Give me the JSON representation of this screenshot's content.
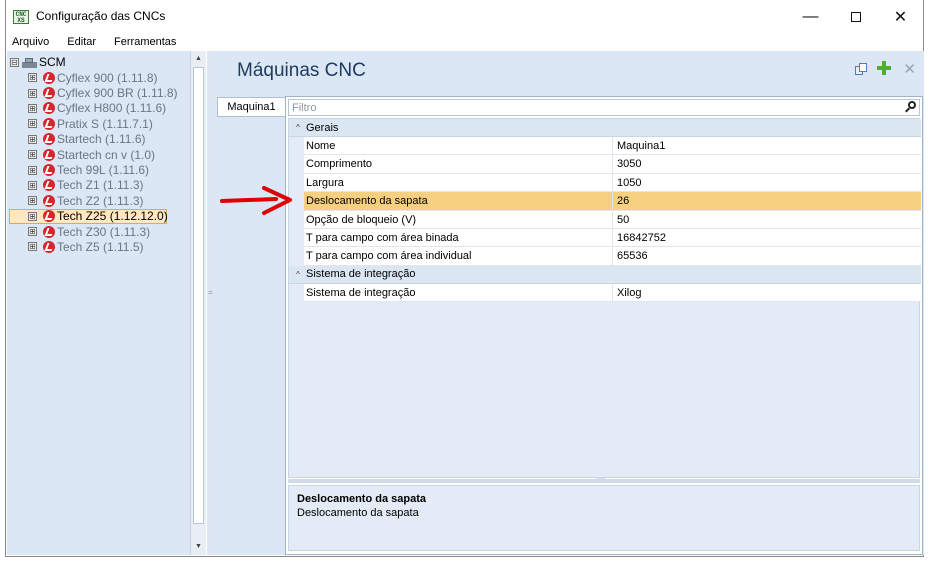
{
  "window": {
    "title": "Configuração das CNCs",
    "app_icon_text_top": "CNC",
    "app_icon_text_bottom": "XS"
  },
  "menu": [
    "Arquivo",
    "Editar",
    "Ferramentas"
  ],
  "tree": {
    "root": {
      "expander": "⊟",
      "label": "SCM"
    },
    "items": [
      {
        "expander": "⊞",
        "label": "Cyflex 900 (1.11.8)",
        "selected": false
      },
      {
        "expander": "⊞",
        "label": "Cyflex 900 BR (1.11.8)",
        "selected": false
      },
      {
        "expander": "⊞",
        "label": "Cyflex H800 (1.11.6)",
        "selected": false
      },
      {
        "expander": "⊞",
        "label": "Pratix S (1.11.7.1)",
        "selected": false
      },
      {
        "expander": "⊞",
        "label": "Startech (1.11.6)",
        "selected": false
      },
      {
        "expander": "⊞",
        "label": "Startech cn v (1.0)",
        "selected": false
      },
      {
        "expander": "⊞",
        "label": "Tech 99L (1.11.6)",
        "selected": false
      },
      {
        "expander": "⊞",
        "label": "Tech Z1 (1.11.3)",
        "selected": false
      },
      {
        "expander": "⊞",
        "label": "Tech Z2 (1.11.3)",
        "selected": false
      },
      {
        "expander": "⊞",
        "label": "Tech Z25 (1.12.12.0)",
        "selected": true
      },
      {
        "expander": "⊞",
        "label": "Tech Z30 (1.11.3)",
        "selected": false
      },
      {
        "expander": "⊞",
        "label": "Tech Z5 (1.11.5)",
        "selected": false
      }
    ]
  },
  "main": {
    "title": "Máquinas CNC",
    "tab_label": "Maquina1",
    "filter_placeholder": "Filtro",
    "categories": [
      {
        "label": "Gerais",
        "toggle": "^",
        "rows": [
          {
            "name": "Nome",
            "value": "Maquina1",
            "selected": false
          },
          {
            "name": "Comprimento",
            "value": "3050",
            "selected": false
          },
          {
            "name": "Largura",
            "value": "1050",
            "selected": false
          },
          {
            "name": "Deslocamento da sapata",
            "value": "26",
            "selected": true
          },
          {
            "name": "Opção de bloqueio (V)",
            "value": "50",
            "selected": false
          },
          {
            "name": "T para campo com área binada",
            "value": "16842752",
            "selected": false
          },
          {
            "name": "T para campo com área individual",
            "value": "65536",
            "selected": false
          }
        ]
      },
      {
        "label": "Sistema de integração",
        "toggle": "^",
        "rows": [
          {
            "name": "Sistema de integração",
            "value": "Xilog",
            "selected": false
          }
        ]
      }
    ],
    "description": {
      "title": "Deslocamento da sapata",
      "text": "Deslocamento da sapata"
    }
  },
  "icons": {
    "tree_node_icon": "cnc-machine-icon",
    "root_icon": "factory-icon",
    "copy": "copy-icon",
    "add": "add-icon",
    "remove": "remove-icon",
    "filter": "search-icon",
    "annotation": "red-arrow-icon"
  },
  "colors": {
    "tree_background": "#dbe7f4",
    "selected_row": "#f7cf80",
    "selected_tree_item": "#fde8c4",
    "title_text": "#1e3a5f",
    "cnc_icon": "#d6262d",
    "add_icon": "#4fae32",
    "arrow": "#e00000"
  }
}
